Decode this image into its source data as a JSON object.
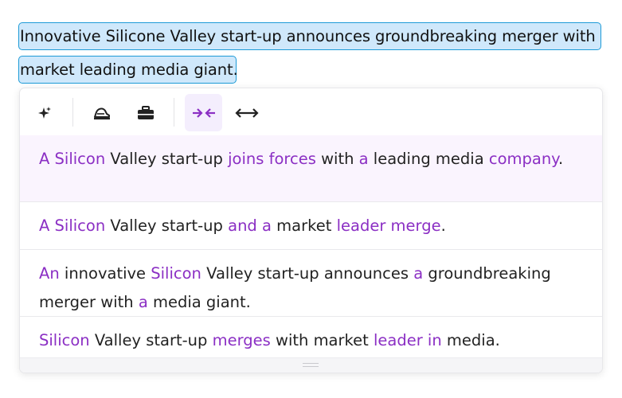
{
  "original": {
    "line1": "Innovative Silicone Valley start-up announces groundbreaking merger with",
    "line2": "market leading media giant."
  },
  "toolbar": {
    "buttons": [
      {
        "icon": "sparkle-icon",
        "active": false
      },
      {
        "icon": "formal-hat-icon",
        "active": false
      },
      {
        "icon": "briefcase-icon",
        "active": false
      },
      {
        "icon": "shorten-icon",
        "active": true
      },
      {
        "icon": "expand-icon",
        "active": false
      }
    ],
    "accent": "#8b2fc4"
  },
  "suggestions": [
    {
      "segments": [
        {
          "t": "A Silicon",
          "changed": true
        },
        {
          "t": " Valley start-up ",
          "changed": false
        },
        {
          "t": "joins forces",
          "changed": true
        },
        {
          "t": " with ",
          "changed": false
        },
        {
          "t": "a",
          "changed": true
        },
        {
          "t": " leading media ",
          "changed": false
        },
        {
          "t": "company",
          "changed": true
        },
        {
          "t": ".",
          "changed": false
        }
      ]
    },
    {
      "segments": [
        {
          "t": "A Silicon",
          "changed": true
        },
        {
          "t": " Valley start-up ",
          "changed": false
        },
        {
          "t": "and a",
          "changed": true
        },
        {
          "t": " market ",
          "changed": false
        },
        {
          "t": "leader merge",
          "changed": true
        },
        {
          "t": ".",
          "changed": false
        }
      ]
    },
    {
      "segments": [
        {
          "t": "An",
          "changed": true
        },
        {
          "t": " innovative ",
          "changed": false
        },
        {
          "t": "Silicon",
          "changed": true
        },
        {
          "t": " Valley start-up announces ",
          "changed": false
        },
        {
          "t": "a",
          "changed": true
        },
        {
          "t": " groundbreaking merger with ",
          "changed": false
        },
        {
          "t": "a",
          "changed": true
        },
        {
          "t": " media giant.",
          "changed": false
        }
      ]
    },
    {
      "segments": [
        {
          "t": "Silicon",
          "changed": true
        },
        {
          "t": " Valley start-up ",
          "changed": false
        },
        {
          "t": "merges",
          "changed": true
        },
        {
          "t": " with market ",
          "changed": false
        },
        {
          "t": "leader in",
          "changed": true
        },
        {
          "t": " media.",
          "changed": false
        }
      ]
    }
  ]
}
